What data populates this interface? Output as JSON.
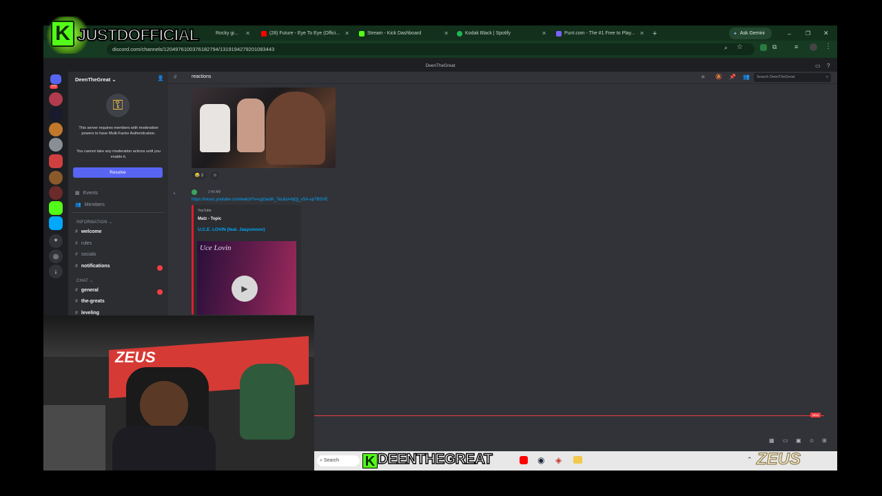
{
  "overlay": {
    "logo_text": "JUSTDOFFICIAL",
    "streamer_name": "DEENTHEGREAT",
    "sponsor": "ZEUS"
  },
  "browser": {
    "tabs": [
      {
        "label": "Rocky gi...",
        "icon": "tab-favicon",
        "color": "#e85d2a"
      },
      {
        "label": "(28) Future - Eye To Eye (Offici...",
        "icon": "youtube-icon",
        "color": "#ff0000"
      },
      {
        "label": "Stream - Kick Dashboard",
        "icon": "kick-icon",
        "color": "#53fc18"
      },
      {
        "label": "Kodak Black | Spotify",
        "icon": "spotify-icon",
        "color": "#1db954"
      },
      {
        "label": "Punt.com - The #1 Free to Play...",
        "icon": "punt-icon",
        "color": "#7b61ff"
      }
    ],
    "new_tab": "+",
    "ask_gemini": "Ask Gemini",
    "url": "discord.com/channels/1204976100376182794/1319194279201083443",
    "title": "DeenTheGreat"
  },
  "discord": {
    "rail_badge": "777",
    "server_name": "DeenTheGreat",
    "mfa_notice": "This server requires members with moderation powers to have Multi-Factor Authentication.",
    "mfa_sub": "You cannot take any moderation actions until you enable it.",
    "resolve_label": "Resolve",
    "nav": {
      "events": "Events",
      "members": "Members"
    },
    "categories": {
      "information": "INFORMATION",
      "chat": "CHAT"
    },
    "channels_info": [
      "welcome",
      "rules",
      "socials",
      "notifications"
    ],
    "channels_chat": [
      "general",
      "the-greats",
      "leveling"
    ],
    "channel_header": "reactions",
    "search_placeholder": "Search DeenTheGreat",
    "reaction_count": "2",
    "message_time": "2:40 AM",
    "link": "https://music.youtube.com/watch?v=cgOastK_Tac&si=bjQj_vSA-upTBSVE",
    "embed_provider": "YouTube",
    "embed_author": "Matz - Topic",
    "embed_title": "U.C.E. LOVIN (feat. Jaaysmoov)",
    "embed_thumb_text": "Uce Lovin",
    "new_marker": "NEW"
  },
  "taskbar": {
    "search_label": "Search"
  },
  "colors": {
    "accent_green": "#53fc18",
    "discord_blurple": "#5865f2",
    "link_blue": "#00a8fc",
    "unread_red": "#f23f43"
  }
}
